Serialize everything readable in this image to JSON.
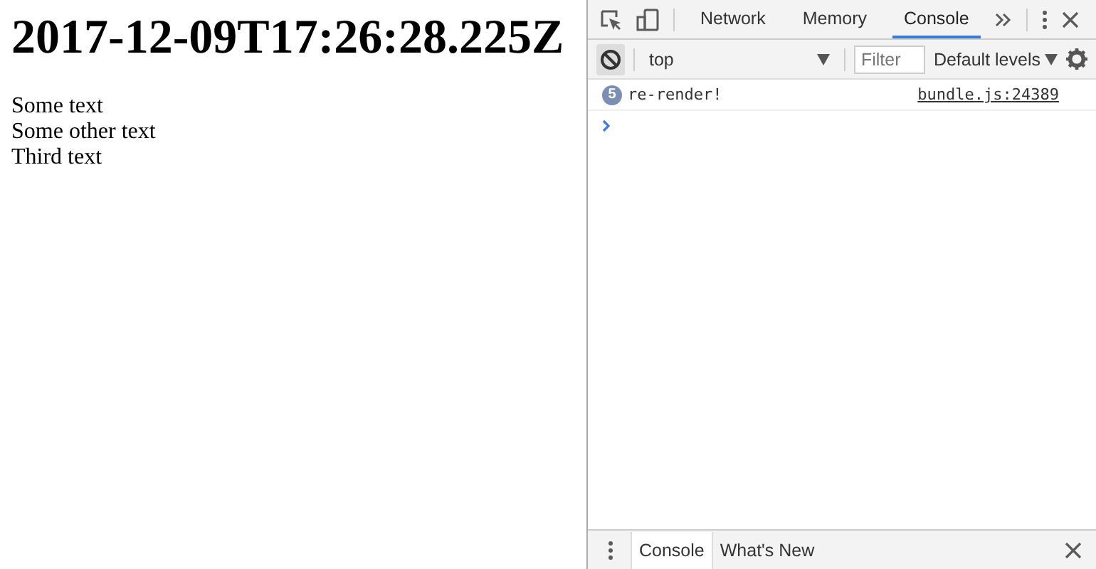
{
  "page": {
    "heading": "2017-12-09T17:26:28.225Z",
    "lines": [
      "Some text",
      "Some other text",
      "Third text"
    ]
  },
  "devtools": {
    "tabs": [
      {
        "label": "Network",
        "selected": false
      },
      {
        "label": "Memory",
        "selected": false
      },
      {
        "label": "Console",
        "selected": true
      }
    ],
    "console_toolbar": {
      "context": "top",
      "filter_placeholder": "Filter",
      "levels": "Default levels"
    },
    "messages": [
      {
        "count": "5",
        "text": "re-render!",
        "source": "bundle.js:24389"
      }
    ],
    "drawer_tabs": [
      {
        "label": "Console",
        "selected": true
      },
      {
        "label": "What's New",
        "selected": false
      }
    ]
  }
}
